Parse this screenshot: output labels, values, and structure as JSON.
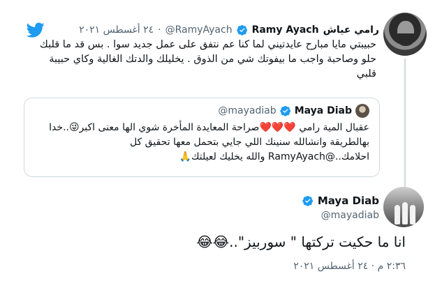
{
  "top_tweet": {
    "name": "Ramy Ayach",
    "name_ar": "رامي عياش",
    "handle": "@RamyAyach",
    "date": "٢٤ أغسطس ٢٠٢١",
    "text": "حبيبتي مايا مبارح عايدتيني لما كنا عم نتفق على عمل جديد سوا . بس قد ما قلبك حلو وصاحبة واجب ما بيفوتك شي من الذوق . يخليلك والدتك الغالية وكاي حبيبة قلبي"
  },
  "quote_tweet": {
    "name": "Maya Diab",
    "handle": "@mayadiab",
    "text": "عقبال المية رامي ❤️❤️❤️صراحة المعايدة المأخرة شوي الها معنى اكبر😜..خدا بهالطريقة وانشالله سنينك اللي جايي بتحمل معها تحقيق كل احلامك..@RamyAyach والله يخليك لعيلتك🙏"
  },
  "main_tweet": {
    "name": "Maya Diab",
    "handle": "@mayadiab",
    "text": "انا ما حكيت تركتها \" سوربيز\"..😂😂",
    "time": "٢:٣٦ م · ٢٤ أغسطس ٢٠٢١"
  },
  "colors": {
    "twitter_blue": "#1d9bf0",
    "secondary_text": "#536471",
    "border": "#cfd9de"
  },
  "icons": [
    "twitter-bird-icon",
    "verified-badge-icon"
  ]
}
